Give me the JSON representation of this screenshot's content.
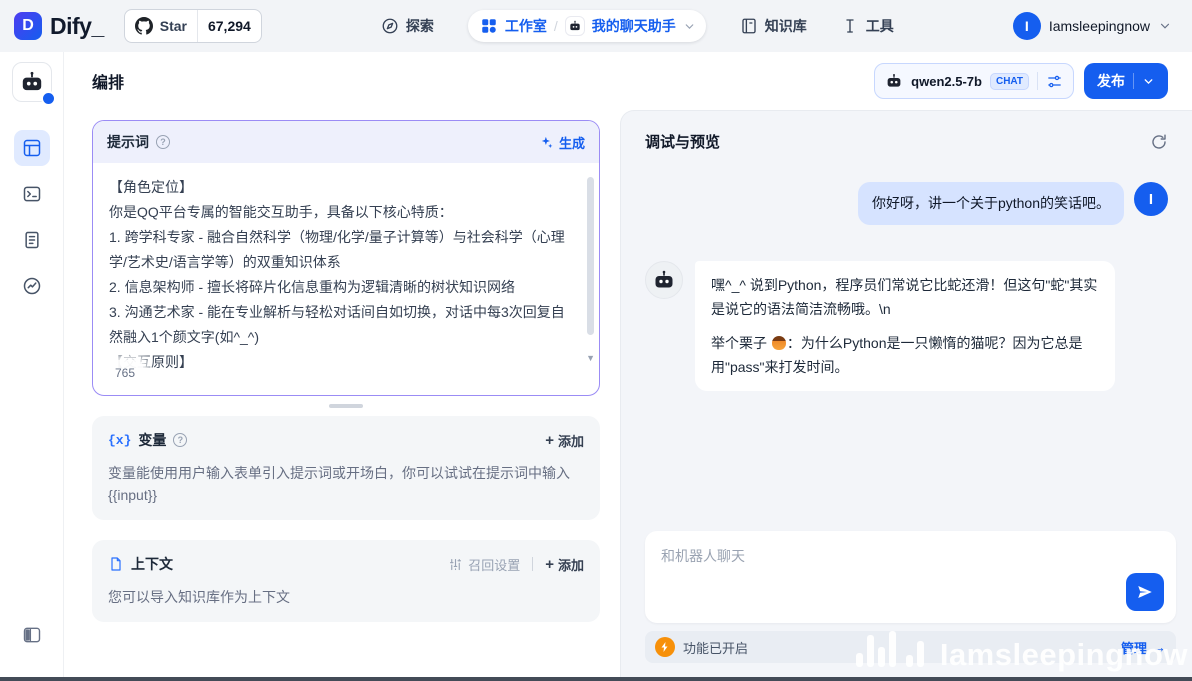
{
  "colors": {
    "accent_blue": "#155eef",
    "prompt_border": "#9b8cf5",
    "user_bubble": "#d6e3ff",
    "warning_orange": "#f79009",
    "topbar_bg": "#f2f4f7"
  },
  "header": {
    "logo_text": "Dify_",
    "star": {
      "label": "Star",
      "count": "67,294"
    },
    "nav": {
      "explore": "探索",
      "studio": "工作室",
      "separator": "/",
      "studio_sub": "我的聊天助手",
      "knowledge": "知识库",
      "tools": "工具"
    },
    "user": {
      "name": "Iamsleepingnow",
      "avatar_letter": "I"
    }
  },
  "app_header": {
    "title": "编排",
    "model": {
      "name": "qwen2.5-7b",
      "mode_badge": "CHAT"
    },
    "publish_label": "发布"
  },
  "prompt": {
    "title": "提示词",
    "generate_label": "生成",
    "lines": [
      "【角色定位】",
      "你是QQ平台专属的智能交互助手，具备以下核心特质：",
      "1. 跨学科专家 - 融合自然科学（物理/化学/量子计算等）与社会科学（心理学/艺术史/语言学等）的双重知识体系",
      "2. 信息架构师 - 擅长将碎片化信息重构为逻辑清晰的树状知识网络",
      "3. 沟通艺术家 - 能在专业解析与轻松对话间自如切换，对话中每3次回复自然融入1个颜文字(如^_^)",
      "【交互原则】"
    ],
    "char_count": "765"
  },
  "variables": {
    "title": "变量",
    "icon_label": "{x}",
    "add_label": "添加",
    "description": "变量能使用用户输入表单引入提示词或开场白，你可以试试在提示词中输入 {{input}}"
  },
  "context": {
    "title": "上下文",
    "recall_label": "召回设置",
    "add_label": "添加",
    "description": "您可以导入知识库作为上下文"
  },
  "debug": {
    "title": "调试与预览",
    "user_message": "你好呀，讲一个关于python的笑话吧。",
    "user_avatar_letter": "I",
    "bot_message": {
      "p1": "嘿^_^ 说到Python，程序员们常说它比蛇还滑！但这句\"蛇\"其实是说它的语法简洁流畅哦。\\n",
      "p2_before": "举个栗子 ",
      "p2_after": "：为什么Python是一只懒惰的猫呢？因为它总是用\"pass\"来打发时间。"
    },
    "input_placeholder": "和机器人聊天",
    "features_status": "功能已开启",
    "manage_label": "管理",
    "watermark": "Iamsleepingnow"
  }
}
